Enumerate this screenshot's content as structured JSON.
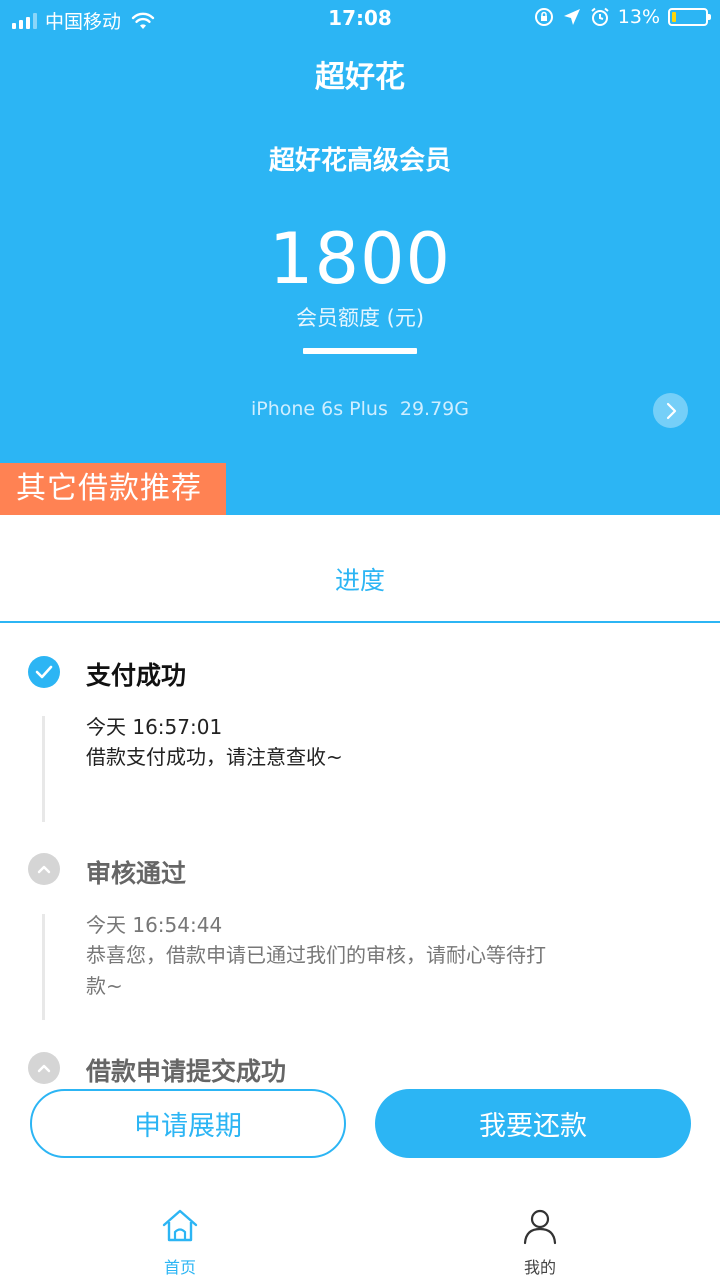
{
  "status_bar": {
    "carrier": "中国移动",
    "time": "17:08",
    "battery_percent": "13%",
    "battery_level": 0.13
  },
  "header": {
    "app_title": "超好花",
    "member_title": "超好花高级会员",
    "quota_value": "1800",
    "quota_label": "会员额度 (元)",
    "device_model": "iPhone 6s Plus",
    "device_storage": "29.79G",
    "promo_tag": "其它借款推荐"
  },
  "progress": {
    "title": "进度",
    "steps": [
      {
        "title": "支付成功",
        "time": "今天 16:57:01",
        "description": "借款支付成功，请注意查收~",
        "status": "done"
      },
      {
        "title": "审核通过",
        "time": "今天 16:54:44",
        "description": "恭喜您，借款申请已通过我们的审核，请耐心等待打款~",
        "status": "pending"
      },
      {
        "title": "借款申请提交成功",
        "status": "pending"
      }
    ]
  },
  "actions": {
    "extend_label": "申请展期",
    "repay_label": "我要还款"
  },
  "tabbar": {
    "home_label": "首页",
    "mine_label": "我的"
  },
  "colors": {
    "primary": "#2cb5f4",
    "promo": "#ff8253",
    "pending_icon": "#d5d5d5"
  },
  "icons": {
    "status": [
      "signal-icon",
      "wifi-icon",
      "orientation-lock-icon",
      "location-icon",
      "alarm-icon",
      "battery-icon"
    ],
    "steps": [
      "check-icon",
      "chevron-up-icon",
      "chevron-up-icon"
    ],
    "tabs": [
      "home-icon",
      "user-icon"
    ]
  }
}
